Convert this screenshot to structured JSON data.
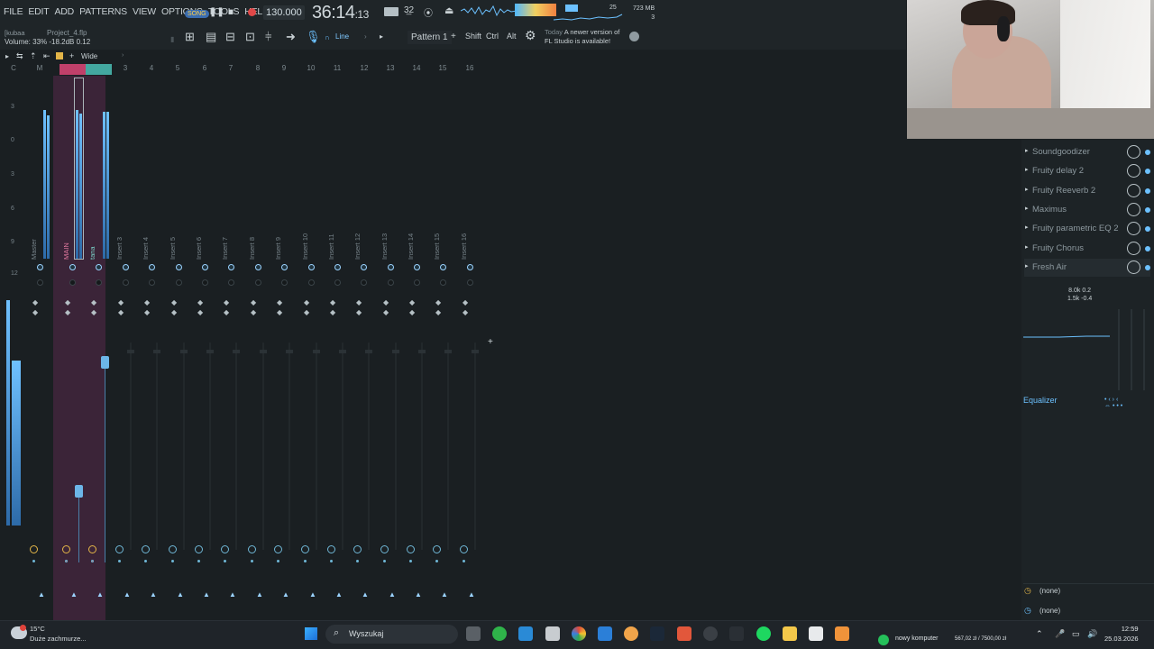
{
  "menu": [
    "FILE",
    "EDIT",
    "ADD",
    "PATTERNS",
    "VIEW",
    "OPTIONS",
    "TOOLS",
    "HELP"
  ],
  "transport": {
    "song_label": "SONG",
    "tempo": "130.000",
    "time_main": "36:14",
    "time_sub": ":13"
  },
  "project": {
    "user": "[kubaa",
    "name": "Project_4.flp",
    "volume_hint": "Volume: 33%  -18.2dB  0.12"
  },
  "toolbar": {
    "line_mode": "Line",
    "pattern": "Pattern 1",
    "keys": [
      "Shift",
      "Ctrl",
      "Alt"
    ]
  },
  "news": {
    "today": "Today",
    "line1": "A newer version of",
    "line2": "FL Studio is available!"
  },
  "stats": {
    "cpu": "25",
    "mem": "723 MB",
    "poly": "3"
  },
  "mixer": {
    "view": "Wide",
    "track_numbers": [
      "C",
      "M",
      "1",
      "2",
      "3",
      "4",
      "5",
      "6",
      "7",
      "8",
      "9",
      "10",
      "11",
      "12",
      "13",
      "14",
      "15",
      "16"
    ],
    "strips": [
      "Master",
      "MAIN",
      "tana",
      "Insert 3",
      "Insert 4",
      "Insert 5",
      "Insert 6",
      "Insert 7",
      "Insert 8",
      "Insert 9",
      "Insert 10",
      "Insert 11",
      "Insert 12",
      "Insert 13",
      "Insert 14",
      "Insert 15",
      "Insert 16"
    ],
    "db_scale": [
      "3",
      "0",
      "3",
      "6",
      "9",
      "12"
    ]
  },
  "effects": {
    "slots": [
      "Soundgoodizer",
      "Fruity delay 2",
      "Fruity Reeverb 2",
      "Maximus",
      "Fruity parametric EQ 2",
      "Fruity Chorus",
      "Fresh Air"
    ],
    "eq_readout_1": "8.0k 0.2",
    "eq_readout_2": "1.5k -0.4",
    "eq_label": "Equalizer",
    "input": "(none)",
    "output": "(none)"
  },
  "taskbar": {
    "temp": "15°C",
    "weather": "Duże zachmurze...",
    "search": "Wyszukaj",
    "tray_name": "nowy komputer",
    "tray_money": "567,02 zł / 7500,00 zł",
    "time": "12:59",
    "date": "25.03.2026"
  },
  "colors": {
    "accent": "#6cc1ff",
    "selected_strip": "#3b2438",
    "record": "#e04848"
  }
}
